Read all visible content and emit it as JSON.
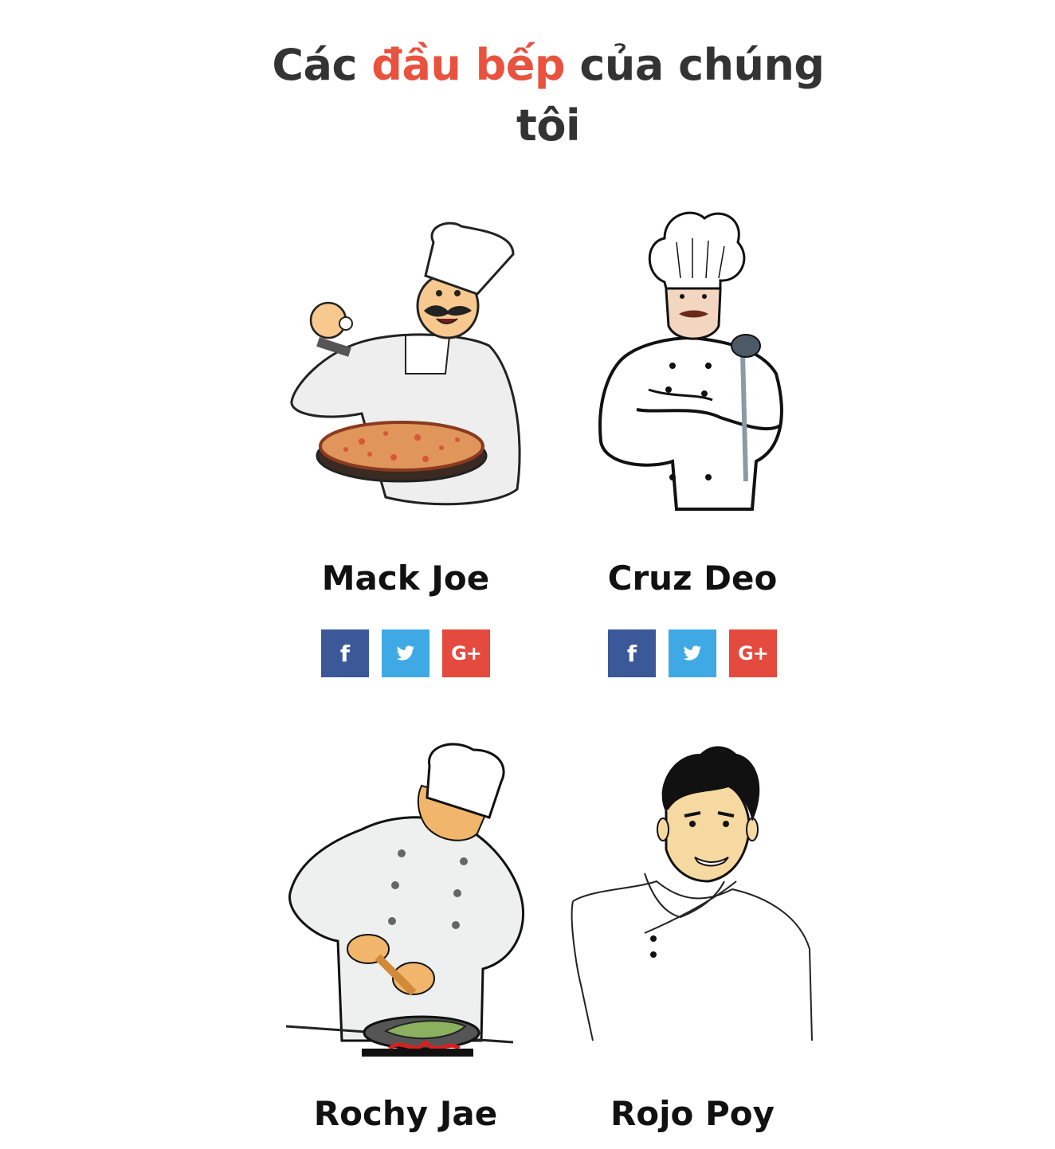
{
  "heading": {
    "part1": "Các ",
    "accent": "đầu bếp",
    "part2": " của chúng",
    "line2": "tôi"
  },
  "colors": {
    "accent": "#e8523f",
    "facebook": "#3b5998",
    "twitter": "#3fa9e6",
    "google_plus": "#e54a3e",
    "heading": "#333333"
  },
  "social_glyphs": {
    "facebook": "f",
    "google_plus": "G+"
  },
  "chefs": [
    {
      "name": "Mack Joe",
      "illustration": "chef-with-pizza"
    },
    {
      "name": "Cruz Deo",
      "illustration": "chef-with-ladle"
    },
    {
      "name": "Rochy Jae",
      "illustration": "chef-cooking-fish"
    },
    {
      "name": "Rojo Poy",
      "illustration": "smiling-chef"
    }
  ]
}
